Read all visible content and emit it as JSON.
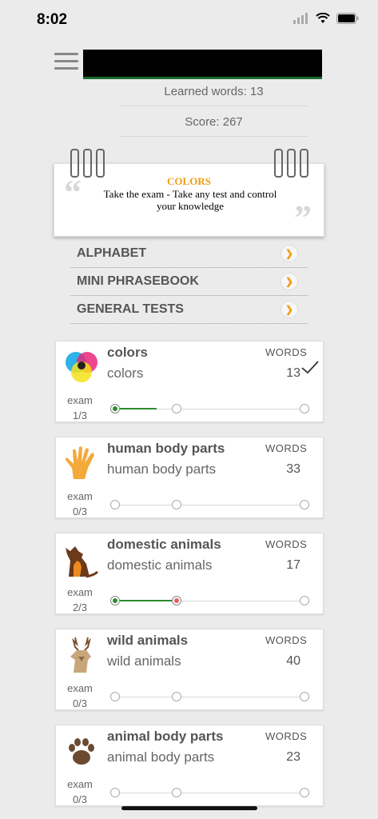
{
  "status": {
    "time": "8:02"
  },
  "stats": {
    "learned": "Learned words: 13",
    "score": "Score: 267"
  },
  "note": {
    "title": "COLORS",
    "text": "Take the exam - Take any test and control your knowledge"
  },
  "menu": [
    {
      "label": "ALPHABET"
    },
    {
      "label": "MINI PHRASEBOOK"
    },
    {
      "label": "GENERAL TESTS"
    }
  ],
  "cards": [
    {
      "title": "colors",
      "subtitle": "colors",
      "words_label": "WORDS",
      "count": "13",
      "exam": "exam",
      "exam_progress": "1/3",
      "icon": "color-wheel-icon"
    },
    {
      "title": "human body parts",
      "subtitle": "human body parts",
      "words_label": "WORDS",
      "count": "33",
      "exam": "exam",
      "exam_progress": "0/3",
      "icon": "hand-icon"
    },
    {
      "title": "domestic animals",
      "subtitle": "domestic animals",
      "words_label": "WORDS",
      "count": "17",
      "exam": "exam",
      "exam_progress": "2/3",
      "icon": "dog-cat-icon"
    },
    {
      "title": "wild animals",
      "subtitle": "wild animals",
      "words_label": "WORDS",
      "count": "40",
      "exam": "exam",
      "exam_progress": "0/3",
      "icon": "deer-icon"
    },
    {
      "title": "animal body parts",
      "subtitle": "animal body parts",
      "words_label": "WORDS",
      "count": "23",
      "exam": "exam",
      "exam_progress": "0/3",
      "icon": "paw-icon"
    }
  ],
  "colors": {
    "accent": "#f39c12",
    "progress": "#2e8b2e"
  }
}
